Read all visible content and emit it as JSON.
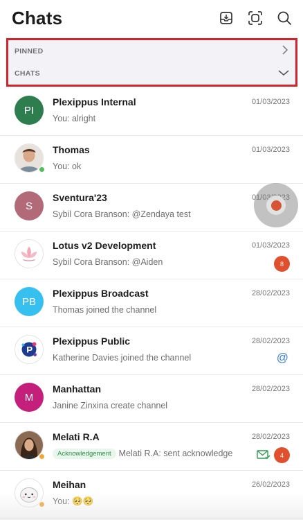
{
  "header": {
    "title": "Chats"
  },
  "sections": {
    "pinned": "PINNED",
    "chats": "CHATS"
  },
  "chats": [
    {
      "name": "Plexippus Internal",
      "date": "01/03/2023",
      "preview": "You: alright",
      "initials": "PI",
      "color": "#2e7d4f"
    },
    {
      "name": "Thomas",
      "date": "01/03/2023",
      "preview": "You: ok",
      "presence": "#4fbf5a"
    },
    {
      "name": "Sventura'23",
      "date": "01/03/2023",
      "preview": "Sybil Cora Branson: @Zendaya test",
      "initials": "S",
      "color": "#b36a78"
    },
    {
      "name": "Lotus v2 Development",
      "date": "01/03/2023",
      "preview": "Sybil Cora Branson: @Aiden",
      "badge": "8"
    },
    {
      "name": "Plexippus Broadcast",
      "date": "28/02/2023",
      "preview": "Thomas joined the channel",
      "initials": "PB",
      "color": "#35c0f0"
    },
    {
      "name": "Plexippus Public",
      "date": "28/02/2023",
      "preview": "Katherine Davies joined the channel",
      "mention": "@"
    },
    {
      "name": "Manhattan",
      "date": "28/02/2023",
      "preview": "Janine Zinxina create channel",
      "initials": "M",
      "color": "#c51f7c"
    },
    {
      "name": "Melati R.A",
      "date": "28/02/2023",
      "tag": "Acknowledgement",
      "preview": "Melati R.A: sent acknowledge",
      "badge": "4",
      "presence": "#f0a63a"
    },
    {
      "name": "Meihan",
      "date": "26/02/2023",
      "preview": "You: 🥺🥺",
      "presence": "#f0a63a"
    }
  ]
}
